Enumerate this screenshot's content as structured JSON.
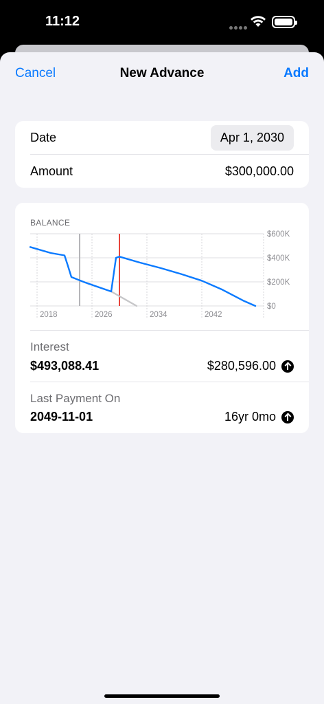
{
  "status": {
    "time": "11:12"
  },
  "nav": {
    "cancel": "Cancel",
    "title": "New Advance",
    "add": "Add"
  },
  "form": {
    "date_label": "Date",
    "date_value": "Apr 1, 2030",
    "amount_label": "Amount",
    "amount_value": "$300,000.00"
  },
  "chart_data": {
    "type": "line",
    "title": "BALANCE",
    "xlabel": "",
    "ylabel": "",
    "x_ticks": [
      "2018",
      "2026",
      "2034",
      "2042"
    ],
    "y_ticks": [
      "$600K",
      "$400K",
      "$200K",
      "$0"
    ],
    "xlim": [
      2017,
      2051
    ],
    "ylim": [
      0,
      600000
    ],
    "grid": true,
    "series": [
      {
        "color": "#0a7aff",
        "x": [
          2017,
          2020,
          2022,
          2022.4,
          2023,
          2025,
          2028.8,
          2029.5,
          2030,
          2033,
          2036,
          2039,
          2042,
          2045,
          2048,
          2049.8
        ],
        "y": [
          490000,
          440000,
          420000,
          350000,
          240000,
          195000,
          120000,
          400000,
          410000,
          360000,
          315000,
          265000,
          210000,
          135000,
          45000,
          0
        ]
      },
      {
        "color": "#c6c6c8",
        "x": [
          2028.8,
          2032.5
        ],
        "y": [
          120000,
          0
        ]
      }
    ],
    "markers": [
      {
        "x": 2024.2,
        "color": "#b5b5b9"
      },
      {
        "x": 2030,
        "color": "#e8453c"
      }
    ]
  },
  "stats": {
    "interest_label": "Interest",
    "interest_value": "$493,088.41",
    "interest_delta": "$280,596.00",
    "last_payment_label": "Last Payment On",
    "last_payment_value": "2049-11-01",
    "last_payment_delta": "16yr 0mo"
  }
}
